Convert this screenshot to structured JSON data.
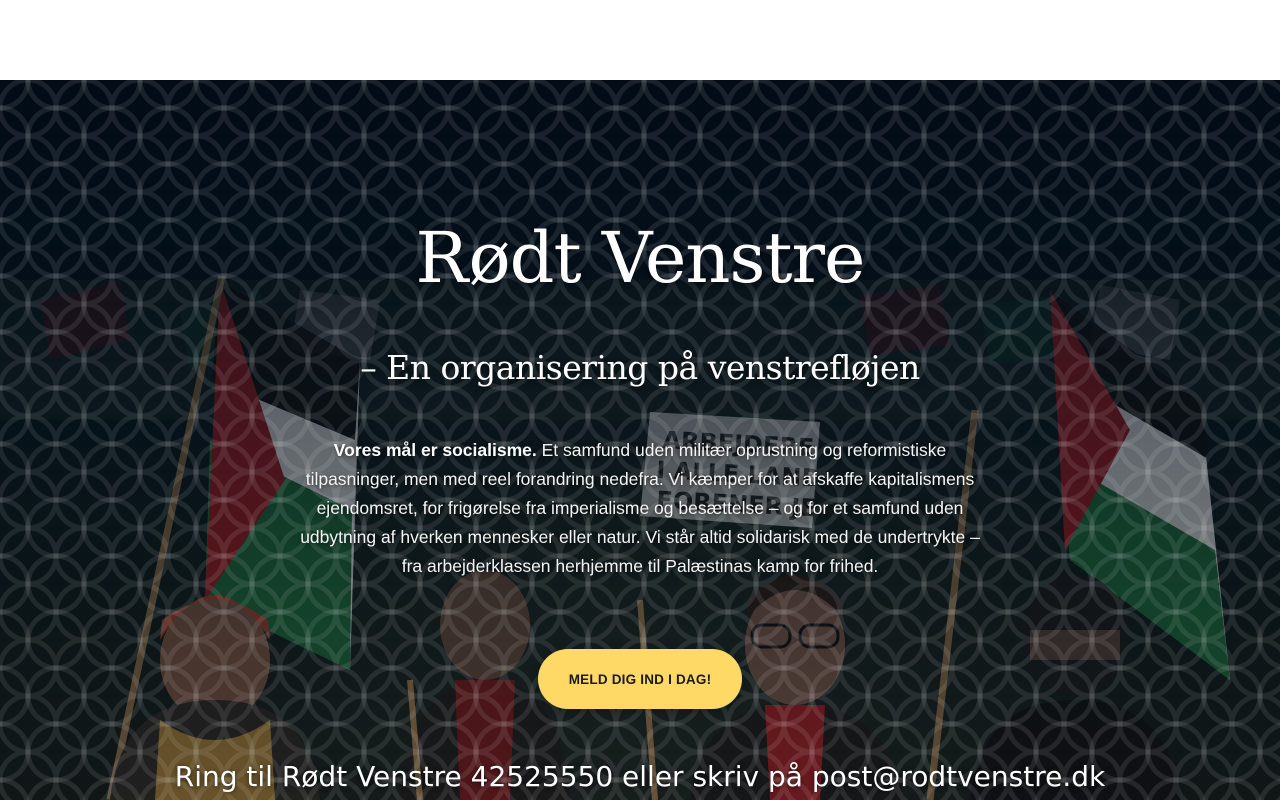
{
  "hero": {
    "title": "Rødt Venstre",
    "tagline": "– En organisering på venstrefløjen",
    "intro_bold": "Vores mål er socialisme.",
    "intro_text": " Et samfund uden militær oprustning og reformistiske tilpasninger, men med reel forandring nedefra. Vi kæmper for at afskaffe kapitalismens ejendomsret, for frigørelse fra imperialisme og besættelse – og for et samfund uden udbytning af hverken mennesker eller natur. Vi står altid solidarisk med de undertrykte – fra arbejderklassen herhjemme til Palæstinas kamp for frihed.",
    "cta_label": "MELD DIG IND I DAG!",
    "contact": "Ring til Rødt Venstre 42525550 eller skriv på post@rodtvenstre.dk",
    "sign_text": "ARBEJDERE I ALLE LANDE FORENER JER!"
  },
  "colors": {
    "overlay": "#02101c",
    "cta_background": "#ffd966",
    "text": "#ffffff",
    "flag_red": "#9e1b22",
    "flag_green": "#1f6b3a",
    "flag_white": "#d8d8d8",
    "flag_black": "#0b0b0b"
  }
}
